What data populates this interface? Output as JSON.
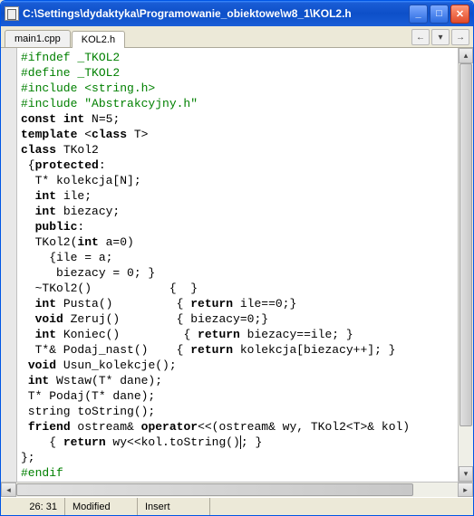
{
  "titlebar": {
    "text": "C:\\Settings\\dydaktyka\\Programowanie_obiektowe\\w8_1\\KOL2.h"
  },
  "winbtns": {
    "min": "_",
    "max": "□",
    "close": "✕"
  },
  "tabs": {
    "t0": "main1.cpp",
    "t1": "KOL2.h"
  },
  "nav": {
    "back": "←",
    "fwd": "→",
    "down": "▾"
  },
  "code": {
    "l1a": "#ifndef _TKOL2",
    "l2a": "#define _TKOL2",
    "l3a": "#include <string.h>",
    "l4a": "#include \"Abstrakcyjny.h\"",
    "l5a": "const",
    "l5b": " ",
    "l5c": "int",
    "l5d": " N=5;",
    "l6a": "template",
    "l6b": " <",
    "l6c": "class",
    "l6d": " T>",
    "l7a": "class",
    "l7b": " TKol2",
    "l8a": " {",
    "l8b": "protected",
    "l8c": ":",
    "l9a": "  T* kolekcja[N];",
    "l10a": "  ",
    "l10b": "int",
    "l10c": " ile;",
    "l11a": "  ",
    "l11b": "int",
    "l11c": " biezacy;",
    "l12a": "  ",
    "l12b": "public",
    "l12c": ":",
    "l13a": "  TKol2(",
    "l13b": "int",
    "l13c": " a=0)",
    "l14a": "    {ile = a;",
    "l15a": "     biezacy = 0; }",
    "l16a": "  ~TKol2()           {  }",
    "l17a": "  ",
    "l17b": "int",
    "l17c": " Pusta()         { ",
    "l17d": "return",
    "l17e": " ile==0;}",
    "l18a": "  ",
    "l18b": "void",
    "l18c": " Zeruj()        { biezacy=0;}",
    "l19a": "  ",
    "l19b": "int",
    "l19c": " Koniec()         { ",
    "l19d": "return",
    "l19e": " biezacy==ile; }",
    "l20a": "  T*& Podaj_nast()    { ",
    "l20b": "return",
    "l20c": " kolekcja[biezacy++]; }",
    "l21a": " ",
    "l21b": "void",
    "l21c": " Usun_kolekcje();",
    "l22a": " ",
    "l22b": "int",
    "l22c": " Wstaw(T* dane);",
    "l23a": " T* Podaj(T* dane);",
    "l24a": " string toString();",
    "l25a": " ",
    "l25b": "friend",
    "l25c": " ostream& ",
    "l25d": "operator",
    "l25e": "<<(ostream& wy, TKol2<T>& kol)",
    "l26a": "    { ",
    "l26b": "return",
    "l26c": " wy<<kol.toString()",
    "l26d": "; }",
    "l27a": "};",
    "l28a": "#endif"
  },
  "scroll": {
    "up": "▴",
    "down": "▾",
    "left": "◂",
    "right": "▸"
  },
  "status": {
    "pos": "26: 31",
    "mod": "Modified",
    "ins": "Insert"
  }
}
